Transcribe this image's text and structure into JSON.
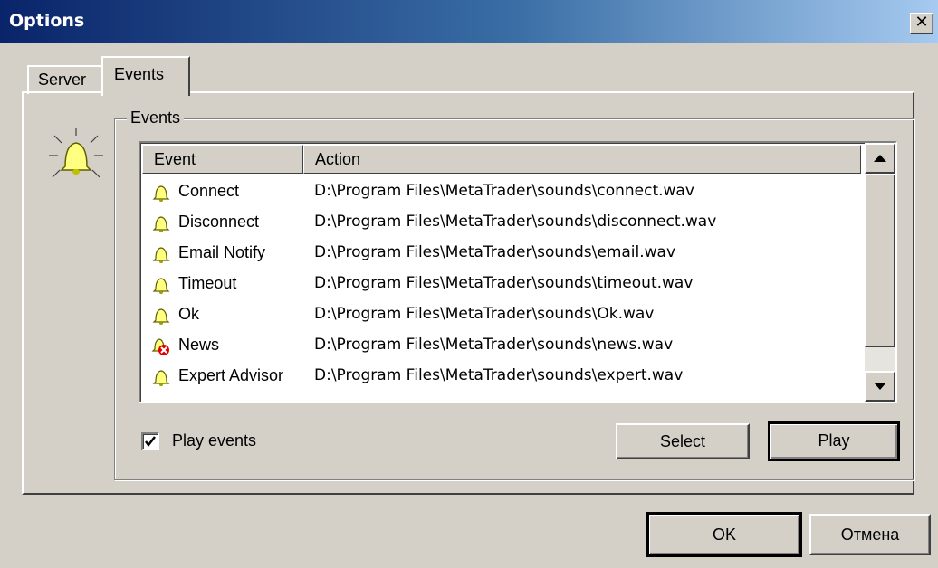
{
  "window": {
    "title": "Options",
    "close_glyph": "✕"
  },
  "tabs": [
    {
      "label": "Server"
    },
    {
      "label": "Events"
    }
  ],
  "events_group": {
    "label": "Events"
  },
  "list": {
    "columns": [
      "Event",
      "Action"
    ],
    "rows": [
      {
        "event": "Connect",
        "action": "D:\\Program Files\\MetaTrader\\sounds\\connect.wav",
        "icon": "bell-icon"
      },
      {
        "event": "Disconnect",
        "action": "D:\\Program Files\\MetaTrader\\sounds\\disconnect.wav",
        "icon": "bell-icon"
      },
      {
        "event": "Email Notify",
        "action": "D:\\Program Files\\MetaTrader\\sounds\\email.wav",
        "icon": "bell-icon"
      },
      {
        "event": "Timeout",
        "action": "D:\\Program Files\\MetaTrader\\sounds\\timeout.wav",
        "icon": "bell-icon"
      },
      {
        "event": "Ok",
        "action": "D:\\Program Files\\MetaTrader\\sounds\\Ok.wav",
        "icon": "bell-icon"
      },
      {
        "event": "News",
        "action": "D:\\Program Files\\MetaTrader\\sounds\\news.wav",
        "icon": "bell-disabled-icon"
      },
      {
        "event": "Expert Advisor",
        "action": "D:\\Program Files\\MetaTrader\\sounds\\expert.wav",
        "icon": "bell-icon"
      }
    ]
  },
  "play_events": {
    "label": "Play events",
    "checked": true
  },
  "buttons": {
    "select": "Select",
    "play": "Play",
    "ok": "OK",
    "cancel": "Отмена"
  },
  "colors": {
    "titlebar_start": "#0a246a",
    "titlebar_end": "#a6caf0",
    "face": "#d4d0c8",
    "bell": "#ffff80"
  }
}
